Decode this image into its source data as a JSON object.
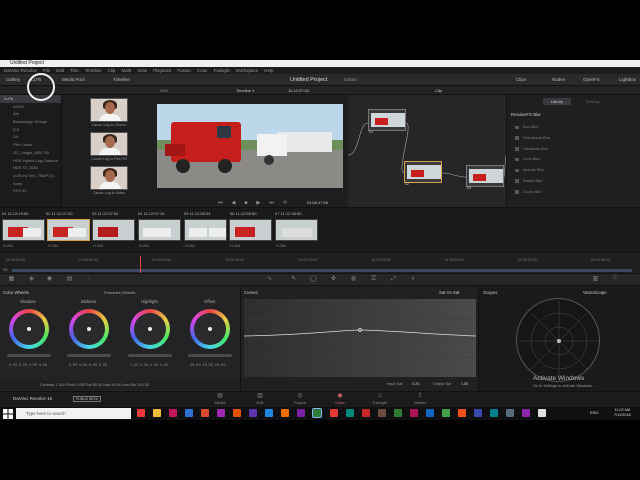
{
  "window": {
    "title": "Untitled Project"
  },
  "menu": [
    "DaVinci Resolve",
    "File",
    "Edit",
    "Trim",
    "Timeline",
    "Clip",
    "Mark",
    "View",
    "Playback",
    "Fusion",
    "Color",
    "Fairlight",
    "Workspace",
    "Help"
  ],
  "toolbar": {
    "gallery": "Gallery",
    "luts": "LUTs",
    "media_pool": "Media Pool",
    "timeline": "Timeline",
    "project_title": "Untitled Project",
    "project_status": "Edited",
    "clips": "Clips",
    "nodes": "Nodes",
    "openfx": "OpenFX",
    "lightbox": "Lightbox"
  },
  "subbar": {
    "zoom": "32%",
    "timeline_name": "Timeline 1",
    "timecode": "11:12:07:20",
    "mode": "Clip"
  },
  "folder_tree": [
    "LUTs",
    "ACES",
    "Arri",
    "Blackmagic Design",
    "DJI",
    "DV",
    "Film Looks",
    "GC_Vsight_835-705",
    "HDR Hybrid Log-Gamma",
    "HDR ST 2084",
    "LUTs by Ven_TBAP (O...",
    "Sony",
    "VFX IO"
  ],
  "media_thumbs": [
    "Canon Log to Cineon",
    "Canon Log to Rec709",
    "Canon Log to Video"
  ],
  "viewer": {
    "timecode": "01:00:17:00"
  },
  "nodes": [
    {
      "label": "01"
    },
    {
      "label": "02"
    },
    {
      "label": "03"
    }
  ],
  "openfx": {
    "tabs": [
      "Library",
      "Settings"
    ],
    "category": "ResolveFX Blur",
    "items": [
      "Box Blur",
      "Directional Blur",
      "Gaussian Blur",
      "Lens Blur",
      "Mosaic Blur",
      "Radial Blur",
      "Zoom Blur"
    ]
  },
  "clips": [
    {
      "num": "01",
      "tc": "11:12:19:50",
      "codec": "H.264"
    },
    {
      "num": "02",
      "tc": "11:12:07:20",
      "codec": "H.264"
    },
    {
      "num": "03",
      "tc": "11:12:07:54",
      "codec": "H.264"
    },
    {
      "num": "04",
      "tc": "11:12:57:26",
      "codec": "H.264"
    },
    {
      "num": "05",
      "tc": "11:12:56:24",
      "codec": "H.264"
    },
    {
      "num": "06",
      "tc": "11:12:58:50",
      "codec": "H.264"
    },
    {
      "num": "07",
      "tc": "11:12:38:50",
      "codec": "H.264"
    }
  ],
  "mini_timeline": {
    "ruler": [
      "00:00:00:00",
      "01:00:04:00",
      "01:00:09:00",
      "01:00:14:00",
      "01:00:19:00",
      "01:00:24:00",
      "01:00:29:00",
      "01:00:33:00",
      "01:00:38:00"
    ],
    "track": "V1"
  },
  "color_wheels": {
    "title": "Color Wheels",
    "mode": "Primaries Wheels",
    "wheels": [
      {
        "name": "Shadow",
        "values": "0.00  0.00  0.00  0.00"
      },
      {
        "name": "Midtone",
        "values": "0.00  0.00  0.00  0.00"
      },
      {
        "name": "Highlight",
        "values": "1.00  1.00  1.00  1.00"
      },
      {
        "name": "Offset",
        "values": "25.00  25.00  25.00"
      }
    ],
    "params": "Contrast 1.000   Pivot 0.435   Sat 50.00   Hue 50.00   Lum Mix 100.00"
  },
  "curves": {
    "title": "Curves",
    "preset": "Sat Vs Sat",
    "input_sat_label": "Input Sat",
    "input_sat": "0.25",
    "output_sat_label": "Output Sat",
    "output_sat": "1.06"
  },
  "scopes": {
    "title": "Scopes",
    "mode": "Vectorscope"
  },
  "watermark": {
    "title": "Activate Windows",
    "sub": "Go to Settings to activate Windows."
  },
  "pages": [
    {
      "label": "Media",
      "icon": "▤"
    },
    {
      "label": "Edit",
      "icon": "▥"
    },
    {
      "label": "Fusion",
      "icon": "◎"
    },
    {
      "label": "Color",
      "icon": "◉"
    },
    {
      "label": "Fairlight",
      "icon": "♫"
    },
    {
      "label": "Deliver",
      "icon": "⇪"
    }
  ],
  "bottom_app": {
    "name": "DaVinci Resolve 15",
    "badge": "PUBLIC BETA"
  },
  "taskbar": {
    "search_placeholder": "Type here to search",
    "time": "11:22 AM",
    "date": "7/11/2018",
    "lang": "ENG"
  },
  "accent_colors": {
    "active_page": "#e06a6a",
    "selection": "#d9a24a"
  }
}
